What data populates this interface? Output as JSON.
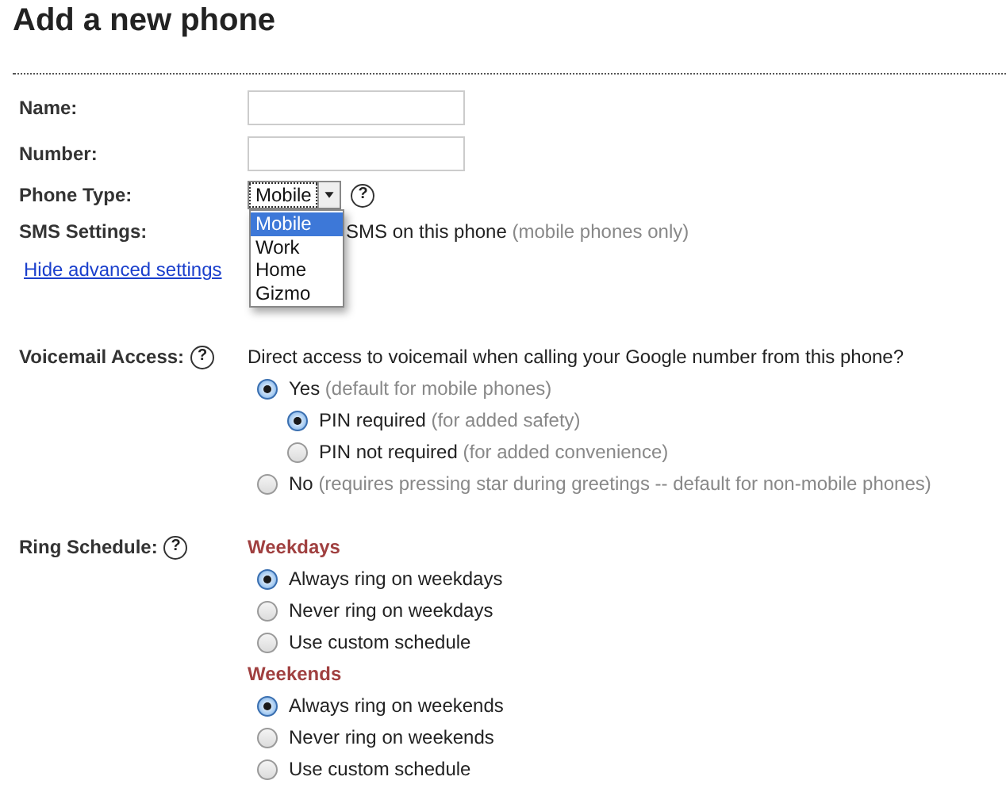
{
  "title": "Add a new phone",
  "fields": [
    {
      "label": "Name:"
    },
    {
      "label": "Number:"
    }
  ],
  "phone_type": {
    "label": "Phone Type:",
    "value": "Mobile",
    "help": "?",
    "expanded": true,
    "options": [
      {
        "label": "Mobile",
        "selected": true
      },
      {
        "label": "Work",
        "selected": false
      },
      {
        "label": "Home",
        "selected": false
      },
      {
        "label": "Gizmo",
        "selected": false
      }
    ]
  },
  "sms": {
    "label": "SMS Settings:",
    "text": "SMS on this phone",
    "note": "(mobile phones only)"
  },
  "advanced_link": "Hide advanced settings",
  "voicemail": {
    "label": "Voicemail Access:",
    "help": "?",
    "question": "Direct access to voicemail when calling your Google number from this phone?",
    "options": [
      {
        "label": "Yes",
        "note": "(default for mobile phones)",
        "selected": true,
        "children": [
          {
            "label": "PIN required",
            "note": "(for added safety)",
            "selected": true
          },
          {
            "label": "PIN not required",
            "note": "(for added convenience)",
            "selected": false
          }
        ]
      },
      {
        "label": "No",
        "note": "(requires pressing star during greetings -- default for non-mobile phones)",
        "selected": false
      }
    ]
  },
  "ring_schedule": {
    "label": "Ring Schedule:",
    "help": "?",
    "groups": [
      {
        "title": "Weekdays",
        "options": [
          {
            "label": "Always ring on weekdays",
            "selected": true
          },
          {
            "label": "Never ring on weekdays",
            "selected": false
          },
          {
            "label": "Use custom schedule",
            "selected": false
          }
        ]
      },
      {
        "title": "Weekends",
        "options": [
          {
            "label": "Always ring on weekends",
            "selected": true
          },
          {
            "label": "Never ring on weekends",
            "selected": false
          },
          {
            "label": "Use custom schedule",
            "selected": false
          }
        ]
      }
    ]
  }
}
